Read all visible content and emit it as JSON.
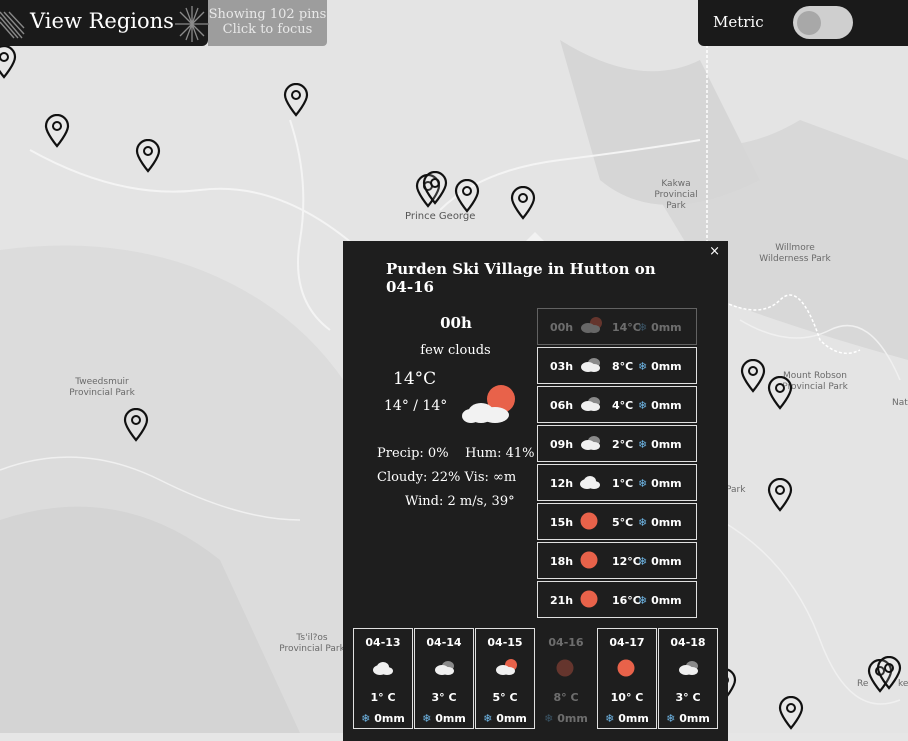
{
  "header": {
    "title": "View Regions"
  },
  "focus_hint": {
    "line1": "Showing 102 pins",
    "line2": "Click to focus"
  },
  "units": {
    "label": "Metric",
    "enabled": false
  },
  "map_labels": {
    "prince_george": "Prince George",
    "kakwa": "Kakwa Provincial Park",
    "willmore": "Willmore Wilderness Park",
    "tweedsmuir": "Tweedsmuir Provincial Park",
    "mount_robson": "Mount Robson Provincial Park",
    "tsilos": "Ts'il?os Provincial Park",
    "nat": "Nat",
    "park": "Park",
    "re": "Re",
    "ke": "ke"
  },
  "popup": {
    "title": "Purden Ski Village in Hutton on 04-16",
    "close": "×",
    "current": {
      "time": "00h",
      "description": "few clouds",
      "temp": "14°C",
      "range": "14° / 14°",
      "icon": "few-clouds-icon",
      "stats_line1": "Precip: 0%    Hum: 41%",
      "stats_line2": "Cloudy: 22% Vis: ∞m",
      "stats_line3": "Wind: 2 m/s, 39°"
    },
    "hourly": [
      {
        "time": "00h",
        "icon": "few-clouds",
        "temp": "14°C",
        "precip": "0mm",
        "selected": true
      },
      {
        "time": "03h",
        "icon": "clouds",
        "temp": "8°C",
        "precip": "0mm"
      },
      {
        "time": "06h",
        "icon": "clouds",
        "temp": "4°C",
        "precip": "0mm"
      },
      {
        "time": "09h",
        "icon": "clouds",
        "temp": "2°C",
        "precip": "0mm"
      },
      {
        "time": "12h",
        "icon": "cloud",
        "temp": "1°C",
        "precip": "0mm"
      },
      {
        "time": "15h",
        "icon": "clear",
        "temp": "5°C",
        "precip": "0mm"
      },
      {
        "time": "18h",
        "icon": "clear",
        "temp": "12°C",
        "precip": "0mm"
      },
      {
        "time": "21h",
        "icon": "clear",
        "temp": "16°C",
        "precip": "0mm"
      }
    ],
    "daily": [
      {
        "date": "04-13",
        "icon": "cloud",
        "temp": "1° C",
        "precip": "0mm"
      },
      {
        "date": "04-14",
        "icon": "clouds",
        "temp": "3° C",
        "precip": "0mm"
      },
      {
        "date": "04-15",
        "icon": "few-clouds",
        "temp": "5° C",
        "precip": "0mm"
      },
      {
        "date": "04-16",
        "icon": "clear",
        "temp": "8° C",
        "precip": "0mm",
        "selected": true
      },
      {
        "date": "04-17",
        "icon": "clear",
        "temp": "10° C",
        "precip": "0mm"
      },
      {
        "date": "04-18",
        "icon": "clouds",
        "temp": "3° C",
        "precip": "0mm"
      }
    ]
  },
  "colors": {
    "sun": "#e8624a",
    "panel": "#1e1e1e",
    "snow": "#6fb6e6"
  }
}
